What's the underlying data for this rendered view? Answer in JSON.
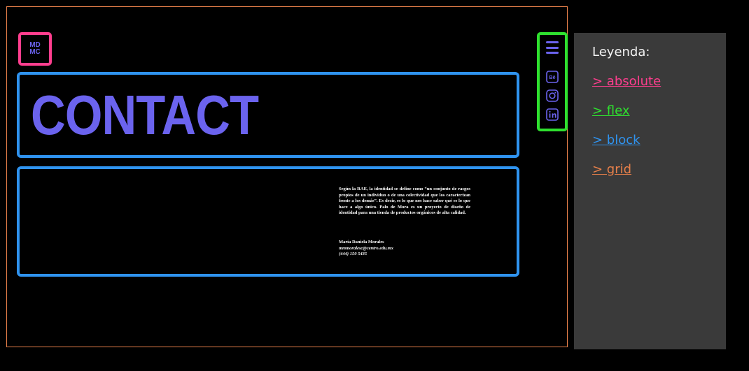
{
  "logo": {
    "text": "MD\nMC"
  },
  "header": {
    "title": "CONTACT"
  },
  "content": {
    "description": "Según la RAE, la identidad se define como “un conjunto de rasgos propios de un individuo o de una colectividad que los caracterizan frente a los demás”. Es decir, es lo que nos hace saber qué es lo que hace a algo único. Palo de Mora es un proyecto de diseño de identidad para una tienda de productos orgánicos de alta calidad.",
    "name": "María Daniela Morales",
    "email": "mmmoralesc@centro.edu.mx",
    "phone": "(444) 150 5435"
  },
  "sidenav": {
    "menu_icon": "hamburger-menu-icon",
    "social_icons": [
      "behance-icon",
      "instagram-icon",
      "linkedin-icon"
    ]
  },
  "legend": {
    "title": "Leyenda:",
    "items": [
      {
        "label": "> absolute",
        "color": "#ff3e8e"
      },
      {
        "label": "> flex",
        "color": "#2fe02f"
      },
      {
        "label": "> block",
        "color": "#2f93ef"
      },
      {
        "label": "> grid",
        "color": "#e8804a"
      }
    ]
  },
  "colors": {
    "accent_purple": "#6b63ee",
    "absolute_pink": "#ff3e8e",
    "flex_green": "#2fe02f",
    "block_blue": "#2f93ef",
    "grid_orange": "#e8804a",
    "legend_bg": "#3a3a3a"
  }
}
